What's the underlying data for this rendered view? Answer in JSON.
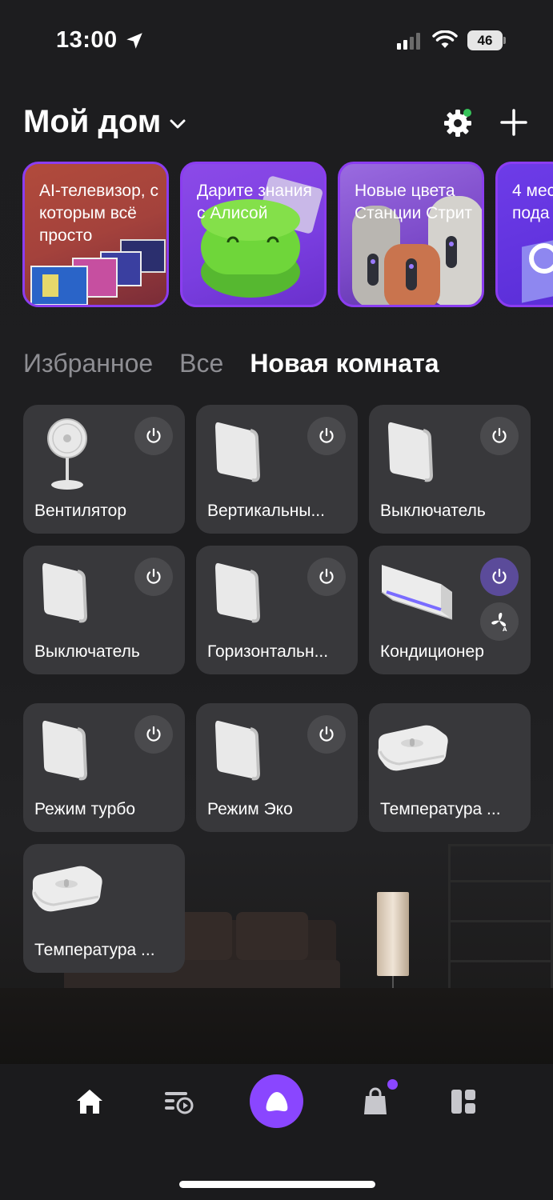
{
  "status_bar": {
    "time": "13:00",
    "battery": "46"
  },
  "header": {
    "title": "Мой дом"
  },
  "stories": [
    {
      "text": "AI-телевизор, с которым всё просто"
    },
    {
      "text": "Дарите знания с Алисой"
    },
    {
      "text": "Новые цвета Станции Стрит"
    },
    {
      "text": "4 мес пода"
    }
  ],
  "tabs": [
    {
      "label": "Избранное",
      "active": false
    },
    {
      "label": "Все",
      "active": false
    },
    {
      "label": "Новая комната",
      "active": true
    }
  ],
  "devices": [
    {
      "name": "Вентилятор",
      "icon": "fan-icon",
      "power": "off"
    },
    {
      "name": "Вертикальны...",
      "icon": "switch-icon",
      "power": "off"
    },
    {
      "name": "Выключатель",
      "icon": "switch-icon",
      "power": "off"
    },
    {
      "name": "Выключатель",
      "icon": "switch-icon",
      "power": "off"
    },
    {
      "name": "Горизонтальн...",
      "icon": "switch-icon",
      "power": "off"
    },
    {
      "name": "Кондиционер",
      "icon": "air-conditioner-icon",
      "power": "on"
    },
    {
      "name": "Режим турбо",
      "icon": "switch-icon",
      "power": "off"
    },
    {
      "name": "Режим Эко",
      "icon": "switch-icon",
      "power": "off"
    },
    {
      "name": "Температура ...",
      "icon": "temperature-sensor-icon"
    },
    {
      "name": "Температура ...",
      "icon": "temperature-sensor-icon"
    }
  ],
  "bottom_nav": [
    {
      "icon": "home-icon"
    },
    {
      "icon": "media-playlist-icon"
    },
    {
      "icon": "alice-icon"
    },
    {
      "icon": "shopping-bag-icon"
    },
    {
      "icon": "dashboard-icon"
    }
  ],
  "colors": {
    "accent": "#8a46ff",
    "tile": "#38383b",
    "notification_dot": "#37c35a"
  }
}
